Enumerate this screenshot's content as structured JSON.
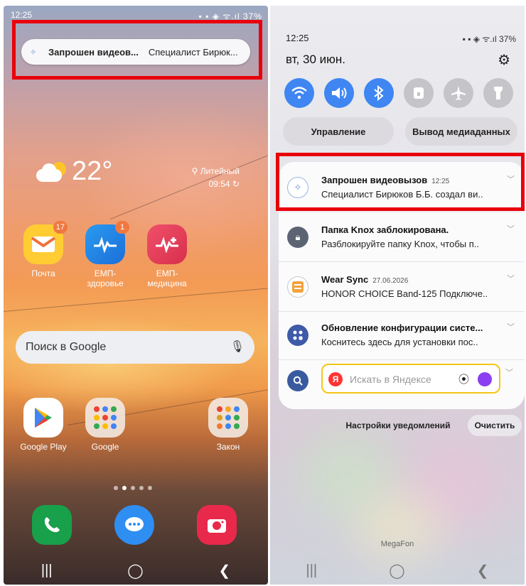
{
  "left_screen": {
    "status_time": "12:25",
    "status_icons": "▪ ▪ ◈ ᯤ.ıl 37%",
    "notification_pill": {
      "icon": "video-call-icon",
      "title": "Запрошен видеов...",
      "subtitle": "Специалист Бирюк..."
    },
    "weather": {
      "temperature": "22°",
      "location": "Литейный",
      "updated": "09:54"
    },
    "apps_row1": [
      {
        "label": "Почта",
        "badge": "17",
        "icon": "mail-icon"
      },
      {
        "label": "ЕМП-здоровье",
        "badge": "1",
        "icon": "emp-health-icon"
      },
      {
        "label": "ЕМП-медицина",
        "badge": "",
        "icon": "emp-medicine-icon"
      }
    ],
    "search": {
      "placeholder": "Поиск в Google"
    },
    "apps_row2": [
      {
        "label": "Google Play"
      },
      {
        "label": "Google"
      },
      {
        "label": "Закон"
      }
    ],
    "dock": [
      "phone-icon",
      "messages-icon",
      "camera-icon"
    ],
    "nav": {
      "recent": "|||",
      "home": "◯",
      "back": "❮"
    }
  },
  "right_screen": {
    "status_time": "12:25",
    "status_icons": "▪ ▪ ◈ ᯤ.ıl 37%",
    "date": "вт, 30 июн.",
    "quick_settings": [
      {
        "name": "wifi",
        "active": true
      },
      {
        "name": "sound",
        "active": true
      },
      {
        "name": "bluetooth",
        "active": true
      },
      {
        "name": "lock",
        "active": false
      },
      {
        "name": "airplane",
        "active": false
      },
      {
        "name": "flashlight",
        "active": false
      }
    ],
    "chips": {
      "control": "Управление",
      "media_output": "Вывод медиаданных"
    },
    "notifications": [
      {
        "title": "Запрошен видеовызов",
        "time": "12:25",
        "body": "Специалист Бирюков Б.Б. создал ви..",
        "icon": "video-call-icon"
      },
      {
        "title": "Папка Knox заблокирована.",
        "time": "",
        "body": "Разблокируйте папку Knox, чтобы п..",
        "icon": "knox-lock-icon"
      },
      {
        "title": "Wear Sync",
        "time": "27.06.2026",
        "body": "HONOR CHOICE Band-125 Подключе..",
        "icon": "wear-sync-icon"
      },
      {
        "title": "Обновление конфигурации систе...",
        "time": "",
        "body": "Коснитесь здесь для установки пос..",
        "icon": "config-update-icon"
      }
    ],
    "yandex": {
      "placeholder": "Искать в Яндексе",
      "logo": "Я"
    },
    "buttons": {
      "notif_settings": "Настройки уведомлений",
      "clear": "Очистить"
    },
    "carrier": "MegaFon",
    "nav": {
      "recent": "|||",
      "home": "◯",
      "back": "❮"
    }
  },
  "colors": {
    "accent_blue": "#3f86f2",
    "highlight_red": "#e8000b",
    "yandex_yellow": "#f5c518"
  }
}
